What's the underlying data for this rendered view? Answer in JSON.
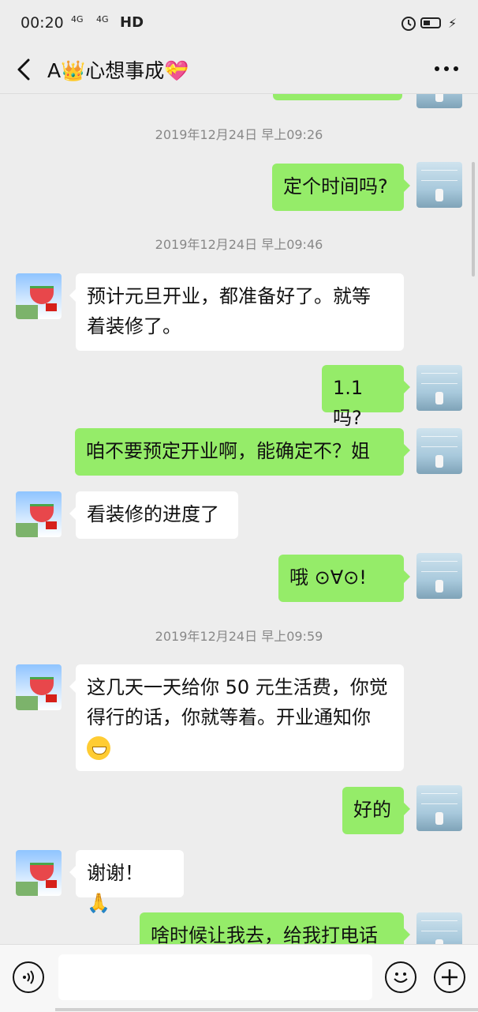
{
  "status_bar": {
    "time": "00:20",
    "signal1": "4G",
    "signal2": "4G",
    "hd": "HD"
  },
  "header": {
    "title": "A👑心想事成💝"
  },
  "messages": [
    {
      "type": "timestamp",
      "text": "2019年12月24日 早上09:26"
    },
    {
      "type": "right",
      "text": "定个时间吗?"
    },
    {
      "type": "timestamp",
      "text": "2019年12月24日 早上09:46"
    },
    {
      "type": "left",
      "line1": "预计元旦开业，都准备好了。就等",
      "line2": "着装修了。"
    },
    {
      "type": "right",
      "text": "1.1 吗?"
    },
    {
      "type": "right",
      "text": "咱不要预定开业啊，能确定不？姐"
    },
    {
      "type": "left",
      "text": "看装修的进度了"
    },
    {
      "type": "right",
      "text": "哦 ⊙∀⊙!"
    },
    {
      "type": "timestamp",
      "text": "2019年12月24日 早上09:59"
    },
    {
      "type": "left",
      "line1": "这几天一天给你 50 元生活费，你觉",
      "line2": "得行的话，你就等着。开业通知你",
      "emoji": "smile"
    },
    {
      "type": "right",
      "text": "好的"
    },
    {
      "type": "left",
      "text": "谢谢！",
      "emoji": "hands"
    },
    {
      "type": "right",
      "text": "啥时候让我去，给我打电话"
    }
  ],
  "icons": {
    "back": "chevron-left-icon",
    "more": "more-dots-icon",
    "voice": "voice-icon",
    "emoji": "emoji-icon",
    "plus": "plus-icon"
  }
}
